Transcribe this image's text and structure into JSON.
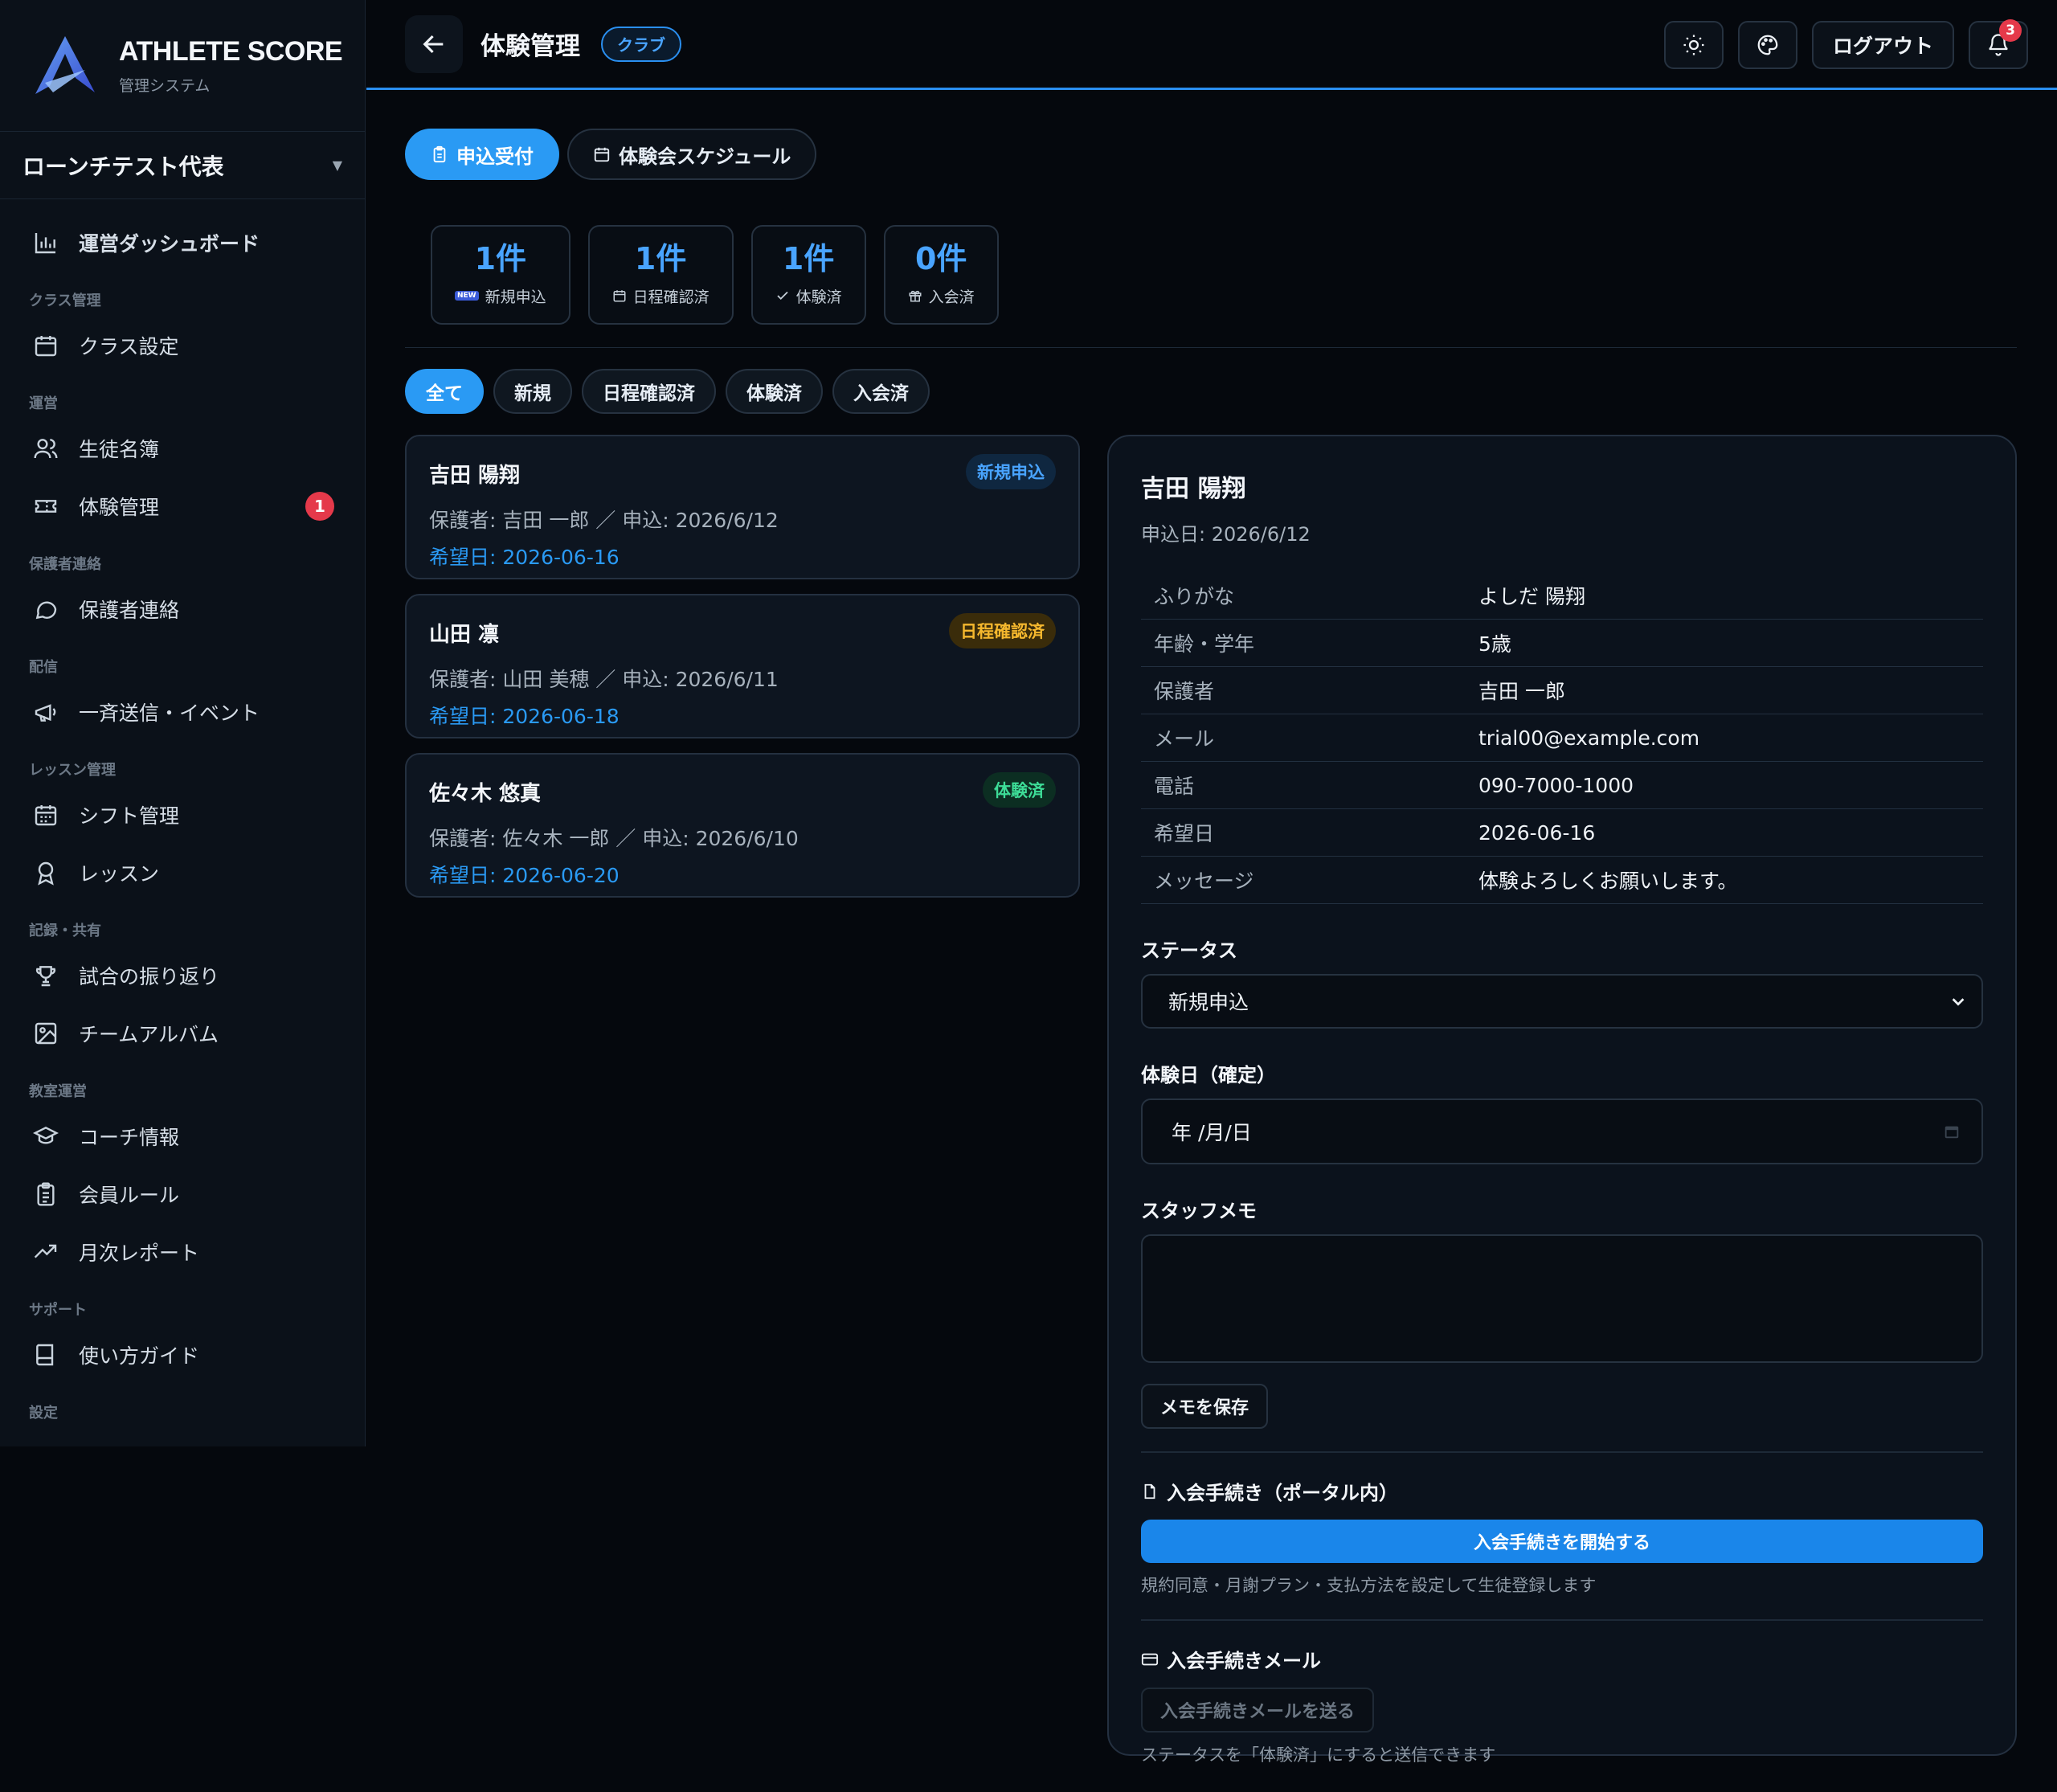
{
  "brand": {
    "title": "ATHLETE SCORE",
    "subtitle": "管理システム"
  },
  "org": {
    "name": "ローンチテスト代表"
  },
  "sidebar": {
    "dashboard": "運営ダッシュボード",
    "sections": {
      "class": "クラス管理",
      "ops": "運営",
      "guardian": "保護者連絡",
      "delivery": "配信",
      "lesson": "レッスン管理",
      "records": "記録・共有",
      "school": "教室運営",
      "support": "サポート",
      "settings": "設定"
    },
    "items": {
      "class_settings": "クラス設定",
      "roster": "生徒名簿",
      "trial": "体験管理",
      "trial_badge": "1",
      "guardian_contact": "保護者連絡",
      "broadcast": "一斉送信・イベント",
      "shift": "シフト管理",
      "lesson": "レッスン",
      "review": "試合の振り返り",
      "album": "チームアルバム",
      "coach": "コーチ情報",
      "rules": "会員ルール",
      "report": "月次レポート",
      "guide": "使い方ガイド"
    }
  },
  "header": {
    "title": "体験管理",
    "badge": "クラブ",
    "logout": "ログアウト",
    "notification_count": "3"
  },
  "tabs": {
    "applications": "申込受付",
    "schedule": "体験会スケジュール"
  },
  "stats": [
    {
      "value": "1件",
      "label": "新規申込",
      "icon": "NEW"
    },
    {
      "value": "1件",
      "label": "日程確認済"
    },
    {
      "value": "1件",
      "label": "体験済"
    },
    {
      "value": "0件",
      "label": "入会済"
    }
  ],
  "filters": {
    "all": "全て",
    "new": "新規",
    "confirmed": "日程確認済",
    "done": "体験済",
    "joined": "入会済"
  },
  "applications": [
    {
      "name": "吉田 陽翔",
      "status": "新規申込",
      "meta": "保護者: 吉田 一郎 ／ 申込: 2026/6/12",
      "date": "希望日: 2026-06-16"
    },
    {
      "name": "山田 凛",
      "status": "日程確認済",
      "meta": "保護者: 山田 美穂 ／ 申込: 2026/6/11",
      "date": "希望日: 2026-06-18"
    },
    {
      "name": "佐々木 悠真",
      "status": "体験済",
      "meta": "保護者: 佐々木 一郎 ／ 申込: 2026/6/10",
      "date": "希望日: 2026-06-20"
    }
  ],
  "detail": {
    "name": "吉田 陽翔",
    "applied": "申込日: 2026/6/12",
    "rows": [
      {
        "k": "ふりがな",
        "v": "よしだ 陽翔"
      },
      {
        "k": "年齢・学年",
        "v": "5歳"
      },
      {
        "k": "保護者",
        "v": "吉田 一郎"
      },
      {
        "k": "メール",
        "v": "trial00@example.com"
      },
      {
        "k": "電話",
        "v": "090-7000-1000"
      },
      {
        "k": "希望日",
        "v": "2026-06-16"
      },
      {
        "k": "メッセージ",
        "v": "体験よろしくお願いします。"
      }
    ],
    "status_label": "ステータス",
    "status_value": "新規申込",
    "trial_date_label": "体験日（確定）",
    "trial_date_placeholder": "年 /月/日",
    "memo_label": "スタッフメモ",
    "memo_save": "メモを保存",
    "join_title": "入会手続き（ポータル内）",
    "join_button": "入会手続きを開始する",
    "join_hint": "規約同意・月謝プラン・支払方法を設定して生徒登録します",
    "mail_title": "入会手続きメール",
    "mail_button": "入会手続きメールを送る",
    "mail_hint": "ステータスを「体験済」にすると送信できます"
  }
}
